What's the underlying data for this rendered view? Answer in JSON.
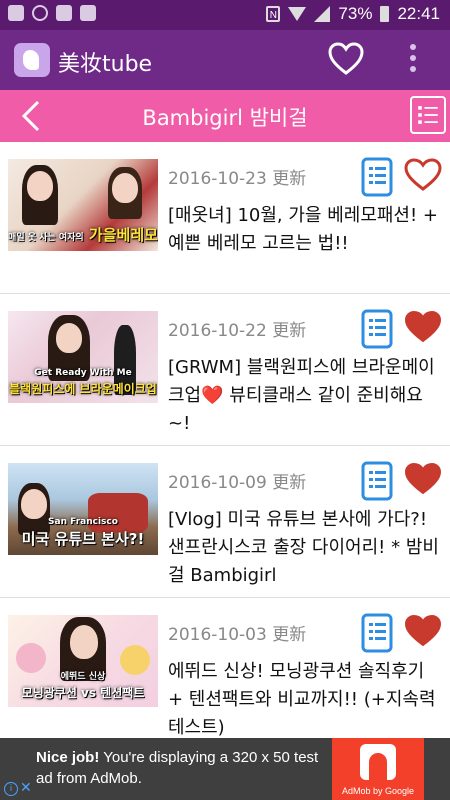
{
  "status_bar": {
    "battery": "73%",
    "time": "22:41"
  },
  "app_bar": {
    "title": "美妆tube"
  },
  "sub_bar": {
    "title": "Bambigirl  밤비걸"
  },
  "items": [
    {
      "date": "2016-10-23 更新",
      "title": "[매옷녀] 10월, 가을 베레모패션! + 예쁜 베레모 고르는 법!!",
      "favorite": false,
      "thumb_caption": "가을베레모",
      "thumb_caption_prefix": "매일 옷 사는 여자의"
    },
    {
      "date": "2016-10-22 更新",
      "title": "[GRWM] 블랙원피스에 브라운메이크업❤️ 뷰티클래스 같이 준비해요~!",
      "favorite": true,
      "thumb_caption": "블랙원피스에 브라운메이크업",
      "thumb_caption_prefix": "Get Ready With Me"
    },
    {
      "date": "2016-10-09 更新",
      "title": "[Vlog] 미국 유튜브 본사에 가다?! 샌프란시스코 출장 다이어리! * 밤비걸 Bambigirl",
      "favorite": true,
      "thumb_caption": "미국 유튜브 본사?!",
      "thumb_caption_prefix": "San Francisco"
    },
    {
      "date": "2016-10-03 更新",
      "title": "에뛰드 신상! 모닝광쿠션 솔직후기 + 텐션팩트와 비교까지!! (+지속력테스트)",
      "favorite": true,
      "thumb_caption": "모닝광쿠션 vs 텐션팩트",
      "thumb_caption_prefix": "에뛰드 신상"
    }
  ],
  "ad": {
    "bold": "Nice job!",
    "text": " You're displaying a 320 x 50 test ad from AdMob.",
    "logo_text": "AdMob by Google"
  },
  "colors": {
    "status_bar": "#5a1a6e",
    "app_bar": "#6e2a86",
    "sub_bar": "#f05ca7",
    "heart_red": "#c8392e",
    "doc_blue": "#2d8de0"
  }
}
